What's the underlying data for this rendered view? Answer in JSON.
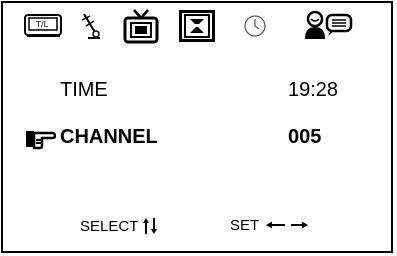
{
  "menu_tabs": [
    {
      "icon": "picture-icon",
      "selected": false
    },
    {
      "icon": "antenna-icon",
      "selected": false
    },
    {
      "icon": "tv-icon",
      "selected": false
    },
    {
      "icon": "timer-menu-icon",
      "selected": true
    },
    {
      "icon": "clock-icon",
      "selected": false
    },
    {
      "icon": "parental-lock-icon",
      "selected": false
    }
  ],
  "settings": {
    "time": {
      "label": "TIME",
      "value": "19:28"
    },
    "channel": {
      "label": "CHANNEL",
      "value": "005",
      "cursor_icon": "pointing-hand-icon"
    }
  },
  "footer": {
    "select_label": "SELECT",
    "select_icon": "up-down-arrows-icon",
    "set_label": "SET",
    "set_icon": "left-right-arrows-icon"
  }
}
